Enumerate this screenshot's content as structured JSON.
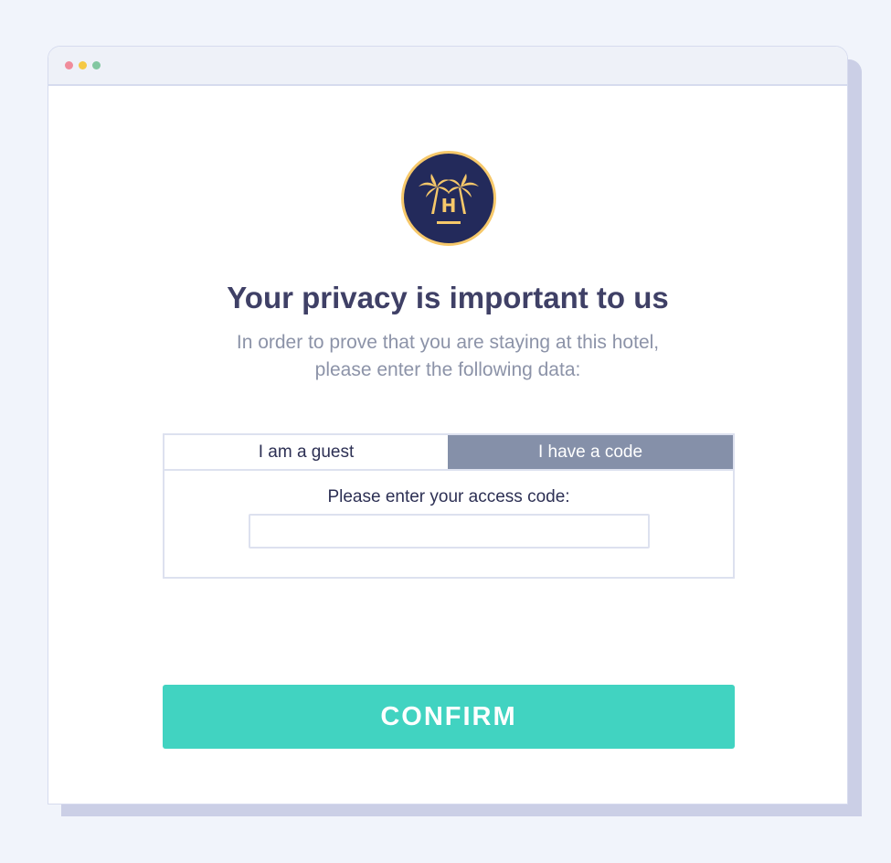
{
  "colors": {
    "page_bg": "#f1f4fb",
    "title": "#3f4066",
    "subtitle": "#8c93a8",
    "active_tab": "#8590a9",
    "confirm": "#41d3c1",
    "logo_bg": "#232a5b",
    "logo_gold": "#f6c86a"
  },
  "window": {
    "controls": [
      "close-dot",
      "minimize-dot",
      "maximize-dot"
    ]
  },
  "logo": {
    "icon": "palm-tree-hotel-logo-icon",
    "letter": "H"
  },
  "header": {
    "title": "Your privacy is important to us",
    "subtitle_line1": "In order to prove that you are staying at this hotel,",
    "subtitle_line2": "please enter the following data:"
  },
  "tabs": [
    {
      "label": "I am a guest",
      "active": false
    },
    {
      "label": "I have a code",
      "active": true
    }
  ],
  "code_form": {
    "label": "Please enter your access code:",
    "value": "",
    "placeholder": ""
  },
  "confirm": {
    "label": "CONFIRM"
  }
}
